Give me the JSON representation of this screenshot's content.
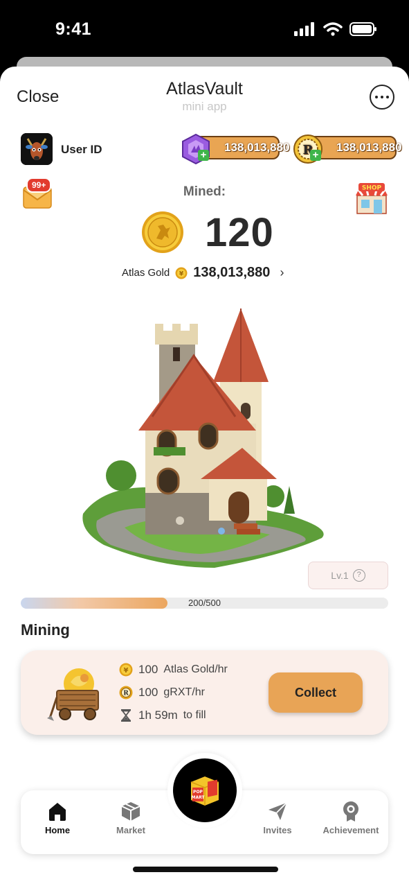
{
  "status_bar": {
    "time": "9:41"
  },
  "header": {
    "close_label": "Close",
    "title": "AtlasVault",
    "subtitle": "mini app"
  },
  "user": {
    "label": "User ID"
  },
  "balances": {
    "gem": "138,013,880",
    "coin": "138,013,880"
  },
  "mail_badge": "99+",
  "shop_label": "SHOP",
  "mined": {
    "label": "Mined:",
    "value": "120"
  },
  "atlas_gold": {
    "label": "Atlas Gold",
    "value": "138,013,880"
  },
  "level": {
    "label": "Lv.1",
    "help": "?"
  },
  "progress": {
    "text": "200/500",
    "current": 200,
    "max": 500
  },
  "mining": {
    "title": "Mining",
    "rates": [
      {
        "amount": "100",
        "unit": "Atlas Gold/hr",
        "icon": "gold-coin-icon"
      },
      {
        "amount": "100",
        "unit": "gRXT/hr",
        "icon": "rxt-coin-icon"
      },
      {
        "amount": "1h 59m",
        "unit": "to fill",
        "icon": "hourglass-icon"
      }
    ],
    "collect_label": "Collect"
  },
  "nav": {
    "items": [
      {
        "label": "Home",
        "icon": "home-icon",
        "active": true
      },
      {
        "label": "Market",
        "icon": "box-icon",
        "active": false
      },
      {
        "label": "Invites",
        "icon": "send-icon",
        "active": false
      },
      {
        "label": "Achievement",
        "icon": "medal-icon",
        "active": false
      }
    ],
    "center": {
      "icon": "pop-mart-box-icon",
      "text": "POP MART"
    }
  },
  "colors": {
    "accent": "#e8a456",
    "pill_border": "#6b3f14",
    "card_bg": "#fbefea"
  }
}
